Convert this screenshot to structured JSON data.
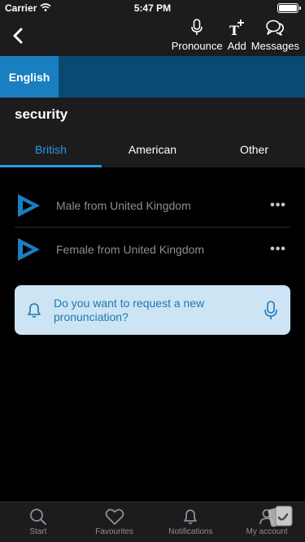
{
  "status": {
    "carrier": "Carrier",
    "time": "5:47 PM"
  },
  "nav": {
    "actions": [
      {
        "label": "Pronounce",
        "icon": "microphone-icon"
      },
      {
        "label": "Add",
        "icon": "add-text-icon"
      },
      {
        "label": "Messages",
        "icon": "chat-bubbles-icon"
      }
    ]
  },
  "language_tab": "English",
  "word": "security",
  "accent_tabs": [
    "British",
    "American",
    "Other"
  ],
  "pronunciations": [
    {
      "label": "Male from United Kingdom"
    },
    {
      "label": "Female from United Kingdom"
    }
  ],
  "request_card": {
    "text": "Do you want to request a new pronunciation?"
  },
  "tab_bar": [
    "Start",
    "Favourites",
    "Notifications",
    "My account"
  ],
  "colors": {
    "accent": "#2a9ae0",
    "language_tab": "#1a7fc1",
    "language_bar": "#0a4a72",
    "request_card": "#cce4f4"
  }
}
